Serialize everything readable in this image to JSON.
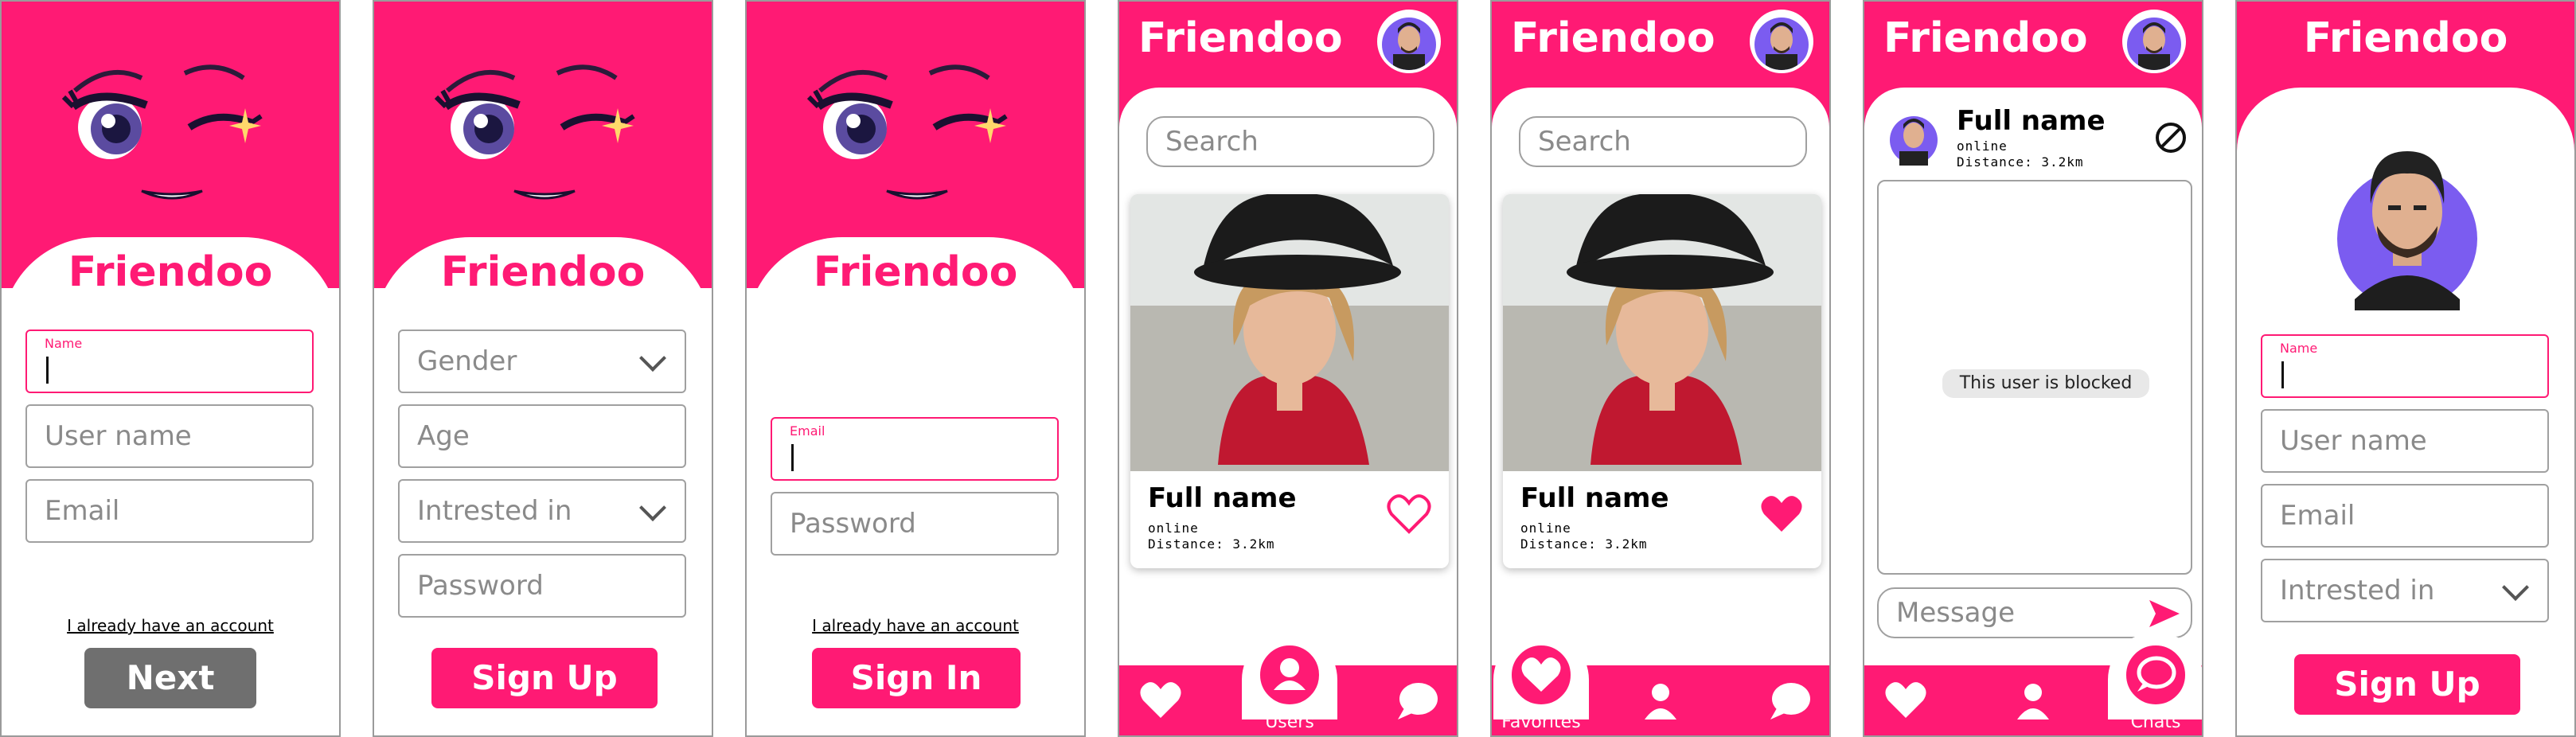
{
  "colors": {
    "brand": "#ff1a74",
    "muted_button": "#6f6f6f",
    "border": "#a0a0a0"
  },
  "app_name": "Friendoo",
  "screen1": {
    "name_label": "Name",
    "username_placeholder": "User name",
    "email_placeholder": "Email",
    "link": "I already have an account",
    "button": "Next"
  },
  "screen2": {
    "gender_placeholder": "Gender",
    "age_placeholder": "Age",
    "interested_placeholder": "Intrested in",
    "password_placeholder": "Password",
    "button": "Sign Up"
  },
  "screen3": {
    "email_label": "Email",
    "password_placeholder": "Password",
    "link": "I already have an account",
    "button": "Sign In"
  },
  "users_screen": {
    "search_placeholder": "Search",
    "card": {
      "name": "Full name",
      "status": "online",
      "distance": "Distance: 3.2km",
      "liked": false
    },
    "nav": {
      "active": "users",
      "active_label": "Users"
    }
  },
  "favorites_screen": {
    "search_placeholder": "Search",
    "card": {
      "name": "Full name",
      "status": "online",
      "distance": "Distance: 3.2km",
      "liked": true
    },
    "nav": {
      "active": "favorites",
      "active_label": "Favorites"
    }
  },
  "chat_screen": {
    "name": "Full name",
    "status": "online",
    "distance": "Distance: 3.2km",
    "blocked_text": "This user is blocked",
    "message_placeholder": "Message",
    "nav": {
      "active": "chats",
      "active_label": "Chats"
    }
  },
  "profile_screen": {
    "name_label": "Name",
    "username_placeholder": "User name",
    "email_placeholder": "Email",
    "interested_placeholder": "Intrested in",
    "button": "Sign Up"
  }
}
